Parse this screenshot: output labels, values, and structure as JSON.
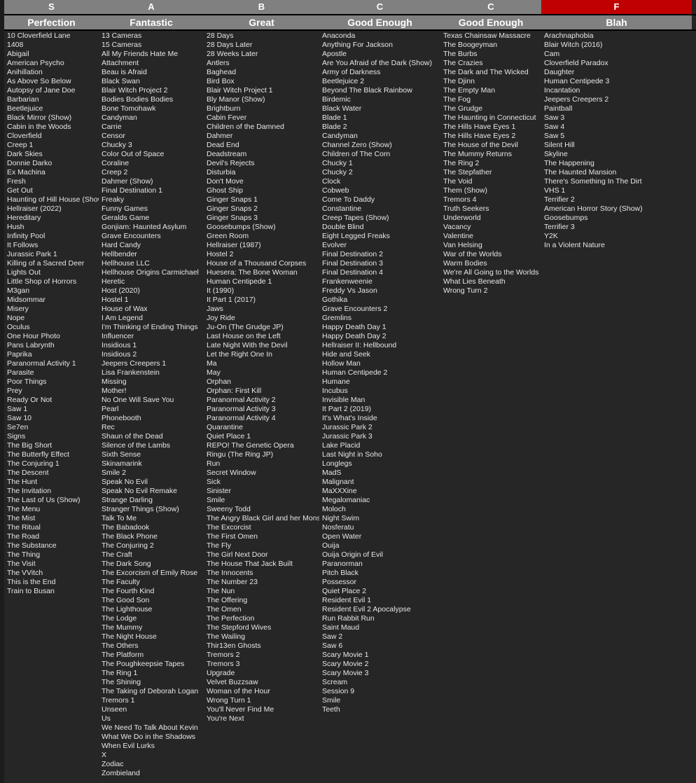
{
  "colors": {
    "header_bg": "#808080",
    "f_tier_bg": "#c00000",
    "background": "#262626",
    "text": "#e6e6e6"
  },
  "columns": [
    {
      "tier": "S",
      "label": "Perfection",
      "items": [
        "10 Cloverfield Lane",
        "1408",
        "Abigail",
        "American Psycho",
        "Anihillation",
        "As Above So Below",
        "Autopsy of Jane Doe",
        "Barbarian",
        "Beetlejuice",
        "Black Mirror (Show)",
        "Cabin in the Woods",
        "Cloverfield",
        "Creep 1",
        "Dark Skies",
        "Donnie Darko",
        "Ex Machina",
        "Fresh",
        "Get Out",
        "Haunting of Hill House (Show",
        "Hellraiser (2022)",
        "Hereditary",
        "Hush",
        "Infinity Pool",
        "It Follows",
        "Jurassic Park 1",
        "Killing of a Sacred Deer",
        "Lights Out",
        "Little Shop of Horrors",
        "M3gan",
        "Midsommar",
        "Misery",
        "Nope",
        "Oculus",
        "One Hour Photo",
        "Pans Labrynth",
        "Paprika",
        "Paranormal Activity 1",
        "Parasite",
        "Poor Things",
        "Prey",
        "Ready Or Not",
        "Saw 1",
        "Saw 10",
        "Se7en",
        "Signs",
        "The Big Short",
        "The Butterfly Effect",
        "The Conjuring 1",
        "The Descent",
        "The Hunt",
        "The Invitation",
        "The Last of Us (Show)",
        "The Menu",
        "The Mist",
        "The Ritual",
        "The Road",
        "The Substance",
        "The Thing",
        "The Visit",
        "The VVitch",
        "This is the End",
        "Train to Busan"
      ]
    },
    {
      "tier": "A",
      "label": "Fantastic",
      "items": [
        "13 Cameras",
        "15 Cameras",
        "All My Friends Hate Me",
        "Attachment",
        "Beau is Afraid",
        "Black Swan",
        "Blair Witch Project 2",
        "Bodies Bodies Bodies",
        "Bone Tomohawk",
        "Candyman",
        "Carrie",
        "Censor",
        "Chucky 3",
        "Color Out of Space",
        "Coraline",
        "Creep 2",
        "Dahmer (Show)",
        "Final Destination 1",
        "Freaky",
        "Funny Games",
        "Geralds Game",
        "Gonjiam: Haunted Asylum",
        "Grave Encounters",
        "Hard Candy",
        "Hellbender",
        "Hellhouse LLC",
        "Hellhouse Origins Carmichael",
        "Heretic",
        "Host (2020)",
        "Hostel 1",
        "House of Wax",
        "I Am Legend",
        "I'm Thinking of Ending Things",
        "Influencer",
        "Insidious 1",
        "Insidious 2",
        "Jeepers Creepers 1",
        "Lisa Frankenstein",
        "Missing",
        "Mother!",
        "No One Will Save You",
        "Pearl",
        "Phonebooth",
        "Rec",
        "Shaun of the Dead",
        "Silence of the Lambs",
        "Sixth Sense",
        "Skinamarink",
        "Smile 2",
        "Speak No Evil",
        "Speak No Evil Remake",
        "Strange Darling",
        "Stranger Things (Show)",
        "Talk To Me",
        "The Babadook",
        "The Black Phone",
        "The Conjuring 2",
        "The Craft",
        "The Dark Song",
        "The Excorcism of Emily Rose",
        "The Faculty",
        "The Fourth Kind",
        "The Good Son",
        "The Lighthouse",
        "The Lodge",
        "The Mummy",
        "The Night House",
        "The Others",
        "The Platform",
        "The Poughkeepsie Tapes",
        "The Ring 1",
        "The Shining",
        "The Taking of Deborah Logan",
        "Tremors 1",
        "Unseen",
        "Us",
        "We Need To Talk About Kevin",
        "What We Do in the Shadows",
        "When Evil Lurks",
        "X",
        "Zodiac",
        "Zombieland"
      ]
    },
    {
      "tier": "B",
      "label": "Great",
      "items": [
        "28 Days",
        "28 Days Later",
        "28 Weeks Later",
        "Antlers",
        "Baghead",
        "Bird Box",
        "Blair Witch Project 1",
        "Bly Manor (Show)",
        "Brightburn",
        "Cabin Fever",
        "Children of the Damned",
        "Dahmer",
        "Dead End",
        "Deadstream",
        "Devil's Rejects",
        "Disturbia",
        "Don't Move",
        "Ghost Ship",
        "Ginger Snaps 1",
        "Ginger Snaps 2",
        "Ginger Snaps 3",
        "Goosebumps (Show)",
        "Green Room",
        "Hellraiser (1987)",
        "Hostel 2",
        "House of a Thousand Corpses",
        "Huesera: The Bone Woman",
        "Human Centipede 1",
        "It (1990)",
        "It Part 1 (2017)",
        "Jaws",
        "Joy Ride",
        "Ju-On (The Grudge JP)",
        "Last House on the Left",
        "Late Night With the Devil",
        "Let the Right One In",
        "Ma",
        "May",
        "Orphan",
        "Orphan: First Kill",
        "Paranormal Activity 2",
        "Paranormal Activity 3",
        "Paranormal Activity 4",
        "Quarantine",
        "Quiet Place 1",
        "REPO! The Genetic Opera",
        "Ringu (The Ring JP)",
        "Run",
        "Secret Window",
        "Sick",
        "Sinister",
        "Smile",
        "Sweeny Todd",
        "The Angry Black Girl and her Monste",
        "The Excorcist",
        "The First Omen",
        "The Fly",
        "The Girl Next Door",
        "The House That Jack Built",
        "The Innocents",
        "The Number 23",
        "The Nun",
        "The Offering",
        "The Omen",
        "The Perfection",
        "The Stepford Wives",
        "The Wailing",
        "Thir13en Ghosts",
        "Tremors 2",
        "Tremors 3",
        "Upgrade",
        "Velvet Buzzsaw",
        "Woman of the Hour",
        "Wrong Turn 1",
        "You'll Never Find Me",
        "You're Next"
      ]
    },
    {
      "tier": "C",
      "label": "Good Enough",
      "items": [
        "Anaconda",
        "Anything For Jackson",
        "Apostle",
        "Are You Afraid of the Dark (Show)",
        "Army of Darkness",
        "Beetlejuice 2",
        "Beyond The Black Rainbow",
        "Birdemic",
        "Black Water",
        "Blade 1",
        "Blade 2",
        "Candyman",
        "Channel Zero (Show)",
        "Children of The Corn",
        "Chucky 1",
        "Chucky 2",
        "Clock",
        "Cobweb",
        "Come To Daddy",
        "Constantine",
        "Creep Tapes (Show)",
        "Double Blind",
        "Eight Legged Freaks",
        "Evolver",
        "Final Destination 2",
        "Final Destination 3",
        "Final Destination 4",
        "Frankenweenie",
        "Freddy Vs Jason",
        "Gothika",
        "Grave Encounters 2",
        "Gremlins",
        "Happy Death Day 1",
        "Happy Death Day 2",
        "Hellraiser II: Hellbound",
        "Hide and Seek",
        "Hollow Man",
        "Human Centipede 2",
        "Humane",
        "Incubus",
        "Invisible Man",
        "It Part 2 (2019)",
        "It's What's Inside",
        "Jurassic Park 2",
        "Jurassic Park 3",
        "Lake Placid",
        "Last Night in Soho",
        "Longlegs",
        "MadS",
        "Malignant",
        "MaXXXine",
        "Megalomaniac",
        "Moloch",
        "Night Swim",
        "Nosferatu",
        "Open Water",
        "Ouija",
        "Ouija Origin of Evil",
        "Paranorman",
        "Pitch Black",
        "Possessor",
        "Quiet Place 2",
        "Resident Evil 1",
        "Resident Evil 2 Apocalypse",
        "Run Rabbit Run",
        "Saint Maud",
        "Saw 2",
        "Saw 6",
        "Scary Movie 1",
        "Scary Movie 2",
        "Scary Movie 3",
        "Scream",
        "Session 9",
        "Smile",
        "Teeth"
      ]
    },
    {
      "tier": "C",
      "label": "Good Enough",
      "items": [
        "Texas Chainsaw Massacre",
        "The Boogeyman",
        "The Burbs",
        "The Crazies",
        "The Dark and The Wicked",
        "The Djinn",
        "The Empty Man",
        "The Fog",
        "The Grudge",
        "The Haunting in Connecticut",
        "The Hills Have Eyes 1",
        "The Hills Have Eyes 2",
        "The House of the Devil",
        "The Mummy Returns",
        "The Ring 2",
        "The Stepfather",
        "The Void",
        "Them (Show)",
        "Tremors 4",
        "Truth Seekers",
        "Underworld",
        "Vacancy",
        "Valentine",
        "Van Helsing",
        "War of the Worlds",
        "Warm Bodies",
        "We're All Going to the Worlds Fair",
        "What Lies Beneath",
        "Wrong Turn 2"
      ]
    },
    {
      "tier": "F",
      "label": "Blah",
      "items": [
        "Arachnaphobia",
        "Blair Witch (2016)",
        "Cam",
        "Cloverfield Paradox",
        "Daughter",
        "Human Centipede 3",
        "Incantation",
        "Jeepers Creepers 2",
        "Paintball",
        "Saw 3",
        "Saw 4",
        "Saw 5",
        "Silent Hill",
        "Skyline",
        "The Happening",
        "The Haunted Mansion",
        "There's Something In The Dirt",
        "VHS 1",
        "Terrifier 2",
        "American Horror Story (Show)",
        "Goosebumps",
        "Terrifier 3",
        "Y2K",
        "In a Violent Nature"
      ]
    }
  ]
}
